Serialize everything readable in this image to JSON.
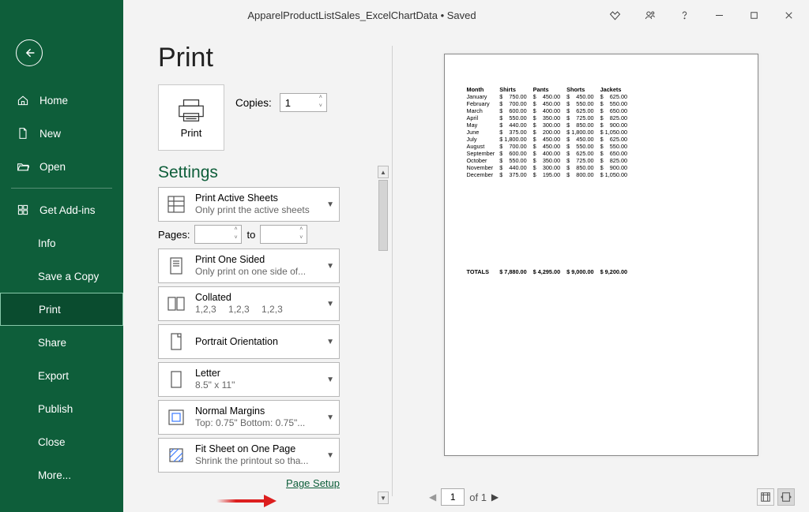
{
  "titlebar": {
    "document": "ApparelProductListSales_ExcelChartData • Saved"
  },
  "sidebar": {
    "items": [
      {
        "label": "Home"
      },
      {
        "label": "New"
      },
      {
        "label": "Open"
      },
      {
        "label": "Get Add-ins"
      },
      {
        "label": "Info"
      },
      {
        "label": "Save a Copy"
      },
      {
        "label": "Print"
      },
      {
        "label": "Share"
      },
      {
        "label": "Export"
      },
      {
        "label": "Publish"
      },
      {
        "label": "Close"
      },
      {
        "label": "More..."
      }
    ]
  },
  "print": {
    "heading": "Print",
    "button": "Print",
    "copies_label": "Copies:",
    "copies_value": "1",
    "settings_heading": "Settings",
    "settings": [
      {
        "l1": "Print Active Sheets",
        "l2": "Only print the active sheets"
      },
      {
        "l1": "Print One Sided",
        "l2": "Only print on one side of..."
      },
      {
        "l1": "Collated",
        "l2": "1,2,3  1,2,3  1,2,3"
      },
      {
        "l1": "Portrait Orientation",
        "l2": ""
      },
      {
        "l1": "Letter",
        "l2": "8.5\" x 11\""
      },
      {
        "l1": "Normal Margins",
        "l2": "Top: 0.75\" Bottom: 0.75\"..."
      },
      {
        "l1": "Fit Sheet on One Page",
        "l2": "Shrink the printout so tha..."
      }
    ],
    "pages_label": "Pages:",
    "pages_to": "to",
    "page_setup": "Page Setup"
  },
  "pager": {
    "current": "1",
    "of": "of 1"
  },
  "chart_data": {
    "type": "table",
    "title": "",
    "columns": [
      "Month",
      "Shirts",
      "Pants",
      "Shorts",
      "Jackets"
    ],
    "rows": [
      {
        "month": "January",
        "shirts": "750.00",
        "pants": "450.00",
        "shorts": "450.00",
        "jackets": "625.00"
      },
      {
        "month": "February",
        "shirts": "700.00",
        "pants": "450.00",
        "shorts": "550.00",
        "jackets": "550.00"
      },
      {
        "month": "March",
        "shirts": "600.00",
        "pants": "400.00",
        "shorts": "625.00",
        "jackets": "650.00"
      },
      {
        "month": "April",
        "shirts": "550.00",
        "pants": "350.00",
        "shorts": "725.00",
        "jackets": "825.00"
      },
      {
        "month": "May",
        "shirts": "440.00",
        "pants": "300.00",
        "shorts": "850.00",
        "jackets": "900.00"
      },
      {
        "month": "June",
        "shirts": "375.00",
        "pants": "200.00",
        "shorts": "1,800.00",
        "jackets": "1,050.00"
      },
      {
        "month": "July",
        "shirts": "1,800.00",
        "pants": "450.00",
        "shorts": "450.00",
        "jackets": "625.00"
      },
      {
        "month": "August",
        "shirts": "700.00",
        "pants": "450.00",
        "shorts": "550.00",
        "jackets": "550.00"
      },
      {
        "month": "September",
        "shirts": "600.00",
        "pants": "400.00",
        "shorts": "625.00",
        "jackets": "650.00"
      },
      {
        "month": "October",
        "shirts": "550.00",
        "pants": "350.00",
        "shorts": "725.00",
        "jackets": "825.00"
      },
      {
        "month": "November",
        "shirts": "440.00",
        "pants": "300.00",
        "shorts": "850.00",
        "jackets": "900.00"
      },
      {
        "month": "December",
        "shirts": "375.00",
        "pants": "195.00",
        "shorts": "800.00",
        "jackets": "1,050.00"
      }
    ],
    "totals": {
      "label": "TOTALS",
      "shirts": "7,880.00",
      "pants": "4,295.00",
      "shorts": "9,000.00",
      "jackets": "9,200.00"
    }
  }
}
